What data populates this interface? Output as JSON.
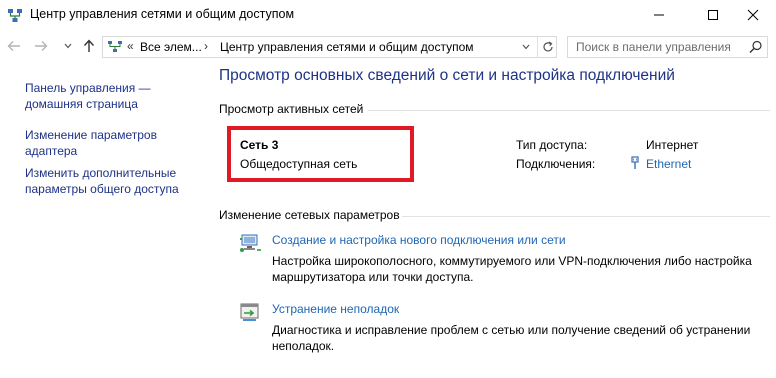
{
  "window": {
    "title": "Центр управления сетями и общим доступом"
  },
  "address_bar": {
    "segments": [
      "Все элем...",
      "Центр управления сетями и общим доступом"
    ],
    "overflow_glyph": "«"
  },
  "search": {
    "placeholder": "Поиск в панели управления"
  },
  "left_pane": {
    "links": [
      {
        "label": "Панель управления — домашняя страница"
      },
      {
        "label": "Изменение параметров адаптера"
      },
      {
        "label": "Изменить дополнительные параметры общего доступа"
      }
    ]
  },
  "main": {
    "title": "Просмотр основных сведений о сети и настройка подключений",
    "active_networks": {
      "heading": "Просмотр активных сетей",
      "network_name": "Сеть  3",
      "network_category": "Общедоступная сеть",
      "access_type_label": "Тип доступа:",
      "access_type_value": "Интернет",
      "connections_label": "Подключения:",
      "connections_value": "Ethernet"
    },
    "change_settings": {
      "heading": "Изменение сетевых параметров",
      "tasks": [
        {
          "link": "Создание и настройка нового подключения или сети",
          "description": "Настройка широкополосного, коммутируемого или VPN-подключения либо настройка маршрутизатора или точки доступа.",
          "icon": "new-connection-icon"
        },
        {
          "link": "Устранение неполадок",
          "description": "Диагностика и исправление проблем с сетью или получение сведений об устранении неполадок.",
          "icon": "troubleshoot-icon"
        }
      ]
    }
  },
  "colors": {
    "link": "#1e3287",
    "task_link": "#1e66b4",
    "highlight_box": "#e01a24"
  }
}
